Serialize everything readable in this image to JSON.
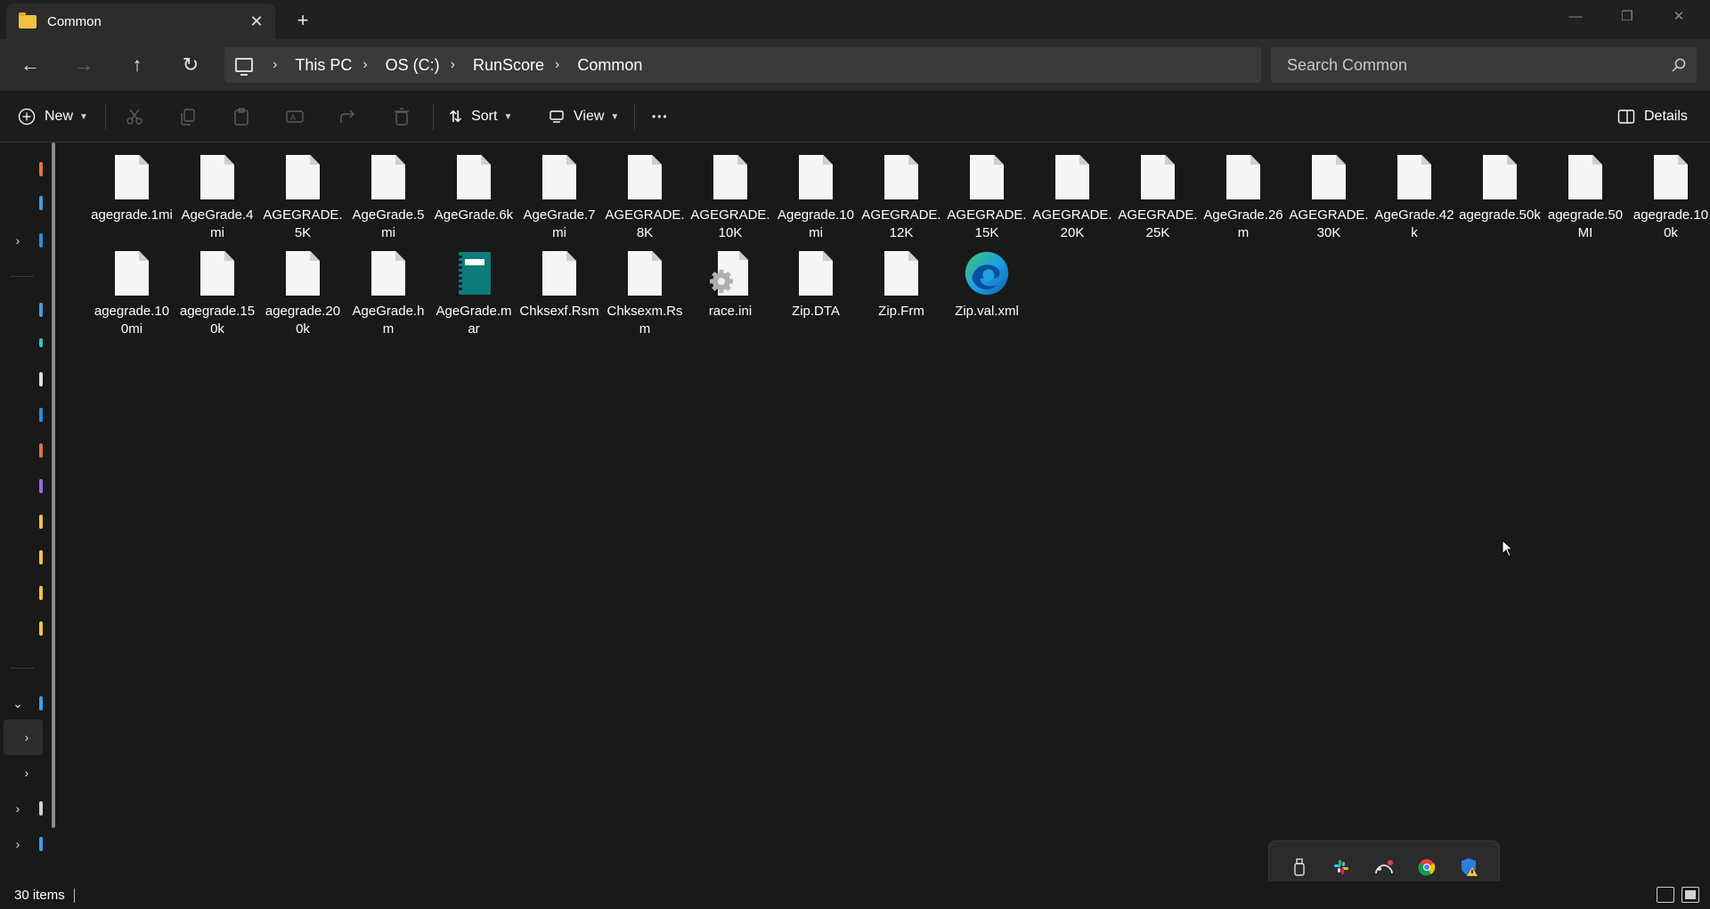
{
  "window": {
    "tab_title": "Common",
    "tab_close": "✕",
    "new_tab": "+",
    "minimize": "—",
    "maximize": "❐",
    "close": "✕"
  },
  "nav": {
    "back": "←",
    "forward": "→",
    "up": "↑",
    "refresh": "↻",
    "breadcrumbs": [
      "This PC",
      "OS (C:)",
      "RunScore",
      "Common"
    ],
    "separator": "›",
    "search_placeholder": "Search Common"
  },
  "toolbar": {
    "new_label": "New",
    "sort_label": "Sort",
    "view_label": "View",
    "more_label": "•••",
    "details_label": "Details"
  },
  "files": [
    {
      "name": "agegrade.1mi",
      "icon": "file-icon"
    },
    {
      "name": "AgeGrade.4mi",
      "icon": "file-icon"
    },
    {
      "name": "AGEGRADE.5K",
      "icon": "file-icon"
    },
    {
      "name": "AgeGrade.5mi",
      "icon": "file-icon"
    },
    {
      "name": "AgeGrade.6k",
      "icon": "file-icon"
    },
    {
      "name": "AgeGrade.7mi",
      "icon": "file-icon"
    },
    {
      "name": "AGEGRADE.8K",
      "icon": "file-icon"
    },
    {
      "name": "AGEGRADE.10K",
      "icon": "file-icon"
    },
    {
      "name": "Agegrade.10mi",
      "icon": "file-icon"
    },
    {
      "name": "AGEGRADE.12K",
      "icon": "file-icon"
    },
    {
      "name": "AGEGRADE.15K",
      "icon": "file-icon"
    },
    {
      "name": "AGEGRADE.20K",
      "icon": "file-icon"
    },
    {
      "name": "AGEGRADE.25K",
      "icon": "file-icon"
    },
    {
      "name": "AgeGrade.26m",
      "icon": "file-icon"
    },
    {
      "name": "AGEGRADE.30K",
      "icon": "file-icon"
    },
    {
      "name": "AgeGrade.42k",
      "icon": "file-icon"
    },
    {
      "name": "agegrade.50k",
      "icon": "file-icon"
    },
    {
      "name": "agegrade.50MI",
      "icon": "file-icon"
    },
    {
      "name": "agegrade.100k",
      "icon": "file-icon"
    },
    {
      "name": "agegrade.100mi",
      "icon": "file-icon"
    },
    {
      "name": "agegrade.150k",
      "icon": "file-icon"
    },
    {
      "name": "agegrade.200k",
      "icon": "file-icon"
    },
    {
      "name": "AgeGrade.hm",
      "icon": "file-icon"
    },
    {
      "name": "AgeGrade.mar",
      "icon": "notebook-icon"
    },
    {
      "name": "Chksexf.Rsm",
      "icon": "file-icon"
    },
    {
      "name": "Chksexm.Rsm",
      "icon": "file-icon"
    },
    {
      "name": "race.ini",
      "icon": "settings-file-icon"
    },
    {
      "name": "Zip.DTA",
      "icon": "file-icon"
    },
    {
      "name": "Zip.Frm",
      "icon": "file-icon"
    },
    {
      "name": "Zip.val.xml",
      "icon": "edge-icon"
    }
  ],
  "status": {
    "item_count": "30 items"
  },
  "colors": {
    "background": "#191919",
    "titlebar": "#202020",
    "navbar": "#2c2c2c",
    "address": "#3a3a3a",
    "folder": "#f3c33f",
    "notebook": "#0f7b7b"
  },
  "tray_icons": [
    "usb-drive-icon",
    "slack-icon",
    "onedrive-sync-icon",
    "chrome-icon",
    "defender-warning-icon"
  ]
}
